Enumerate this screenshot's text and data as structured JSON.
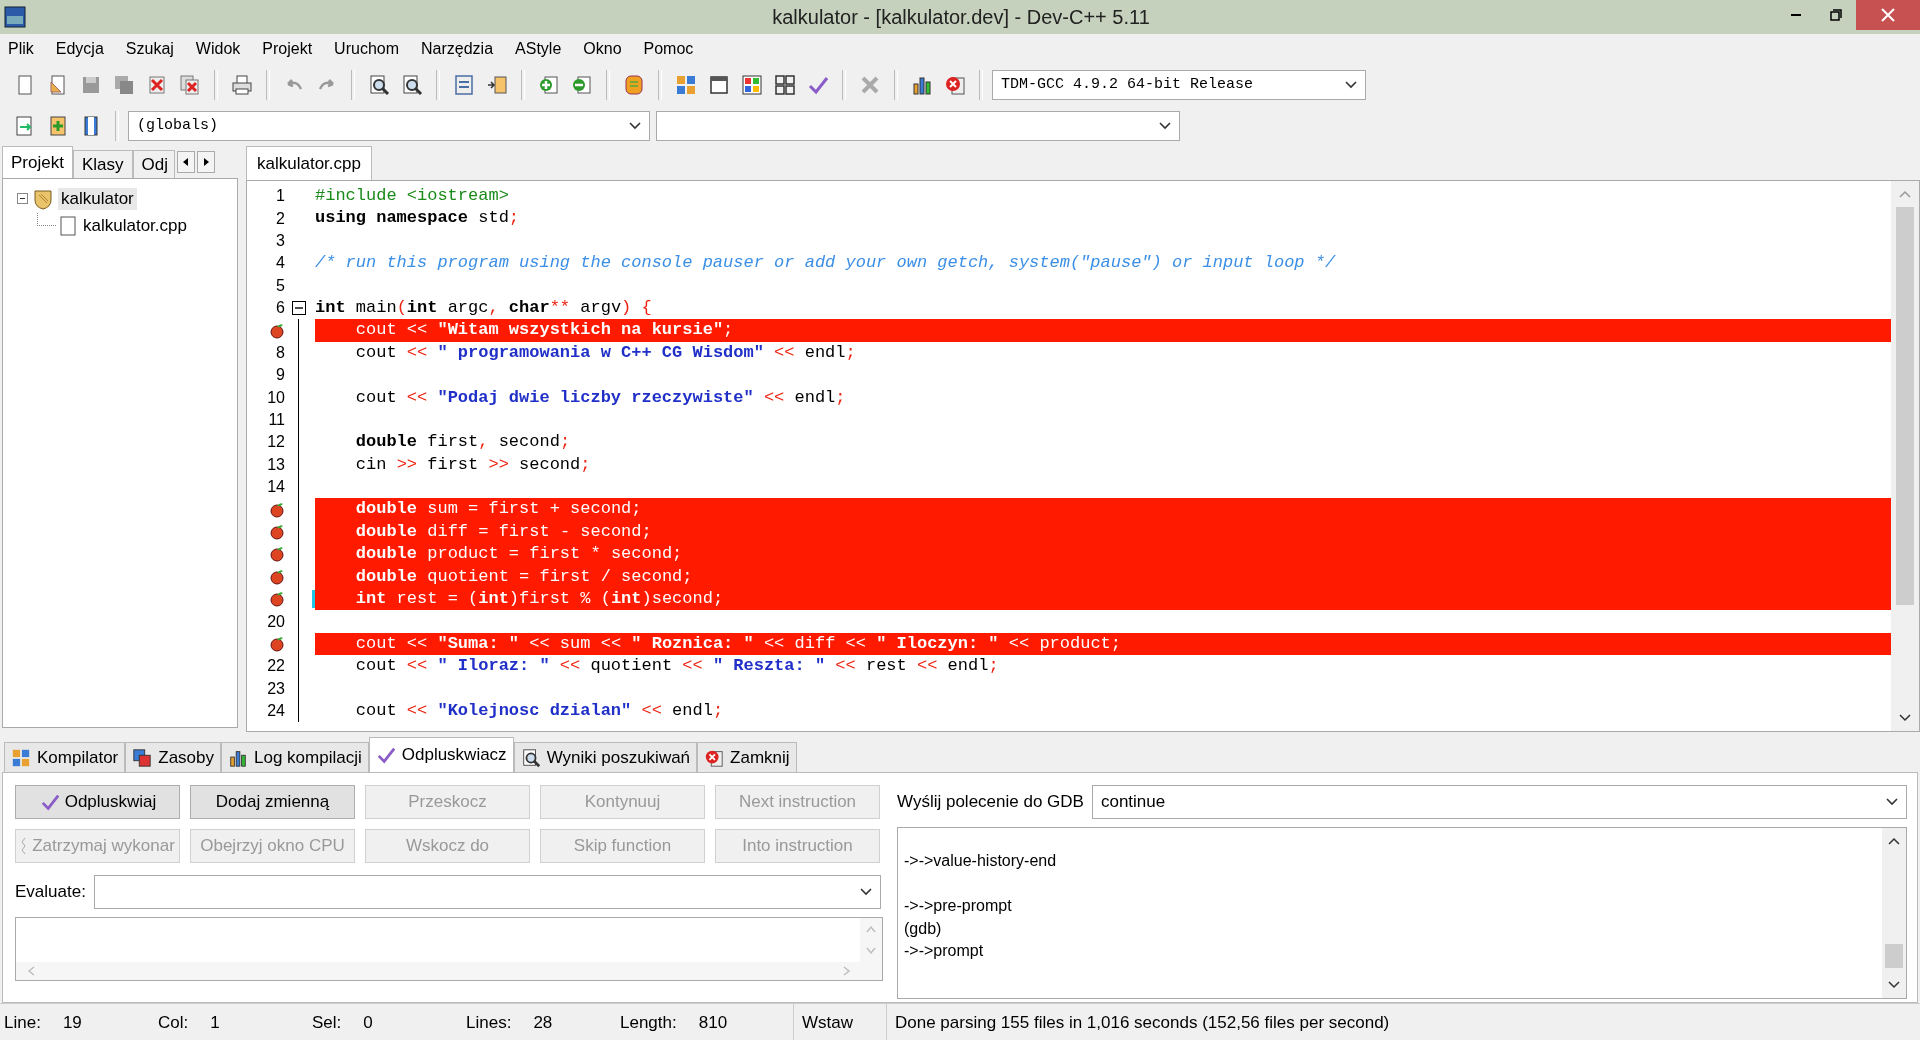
{
  "window": {
    "title": "kalkulator - [kalkulator.dev] - Dev-C++ 5.11"
  },
  "menu": [
    "Plik",
    "Edycja",
    "Szukaj",
    "Widok",
    "Projekt",
    "Uruchom",
    "Narzędzia",
    "AStyle",
    "Okno",
    "Pomoc"
  ],
  "toolbar": {
    "compiler": "TDM-GCC 4.9.2 64-bit Release",
    "scope": "(globals)"
  },
  "left_panel": {
    "tabs": [
      {
        "label": "Projekt",
        "selected": true
      },
      {
        "label": "Klasy",
        "selected": false
      },
      {
        "label": "Odj",
        "selected": false
      }
    ],
    "tree": [
      {
        "label": "kalkulator",
        "expanded": true,
        "children": [
          {
            "label": "kalkulator.cpp"
          }
        ]
      }
    ]
  },
  "editor": {
    "tabs": [
      {
        "label": "kalkulator.cpp",
        "selected": true
      }
    ],
    "lines": [
      {
        "number": "1",
        "tokens": [
          {
            "kind": "pp",
            "text": "#include <iostream>"
          }
        ]
      },
      {
        "number": "2",
        "tokens": [
          {
            "kind": "kw",
            "text": "using namespace"
          },
          {
            "kind": "id",
            "text": " std"
          },
          {
            "kind": "sym",
            "text": ";"
          }
        ]
      },
      {
        "number": "3"
      },
      {
        "number": "4",
        "tokens": [
          {
            "kind": "cm",
            "text": "/* run this program using the console pauser or add your own getch, system(\"pause\") or input loop */"
          }
        ]
      },
      {
        "number": "5"
      },
      {
        "number": "6",
        "fold_start": true,
        "tokens": [
          {
            "kind": "kw",
            "text": "int"
          },
          {
            "kind": "id",
            "text": " main"
          },
          {
            "kind": "sym",
            "text": "("
          },
          {
            "kind": "kw",
            "text": "int"
          },
          {
            "kind": "id",
            "text": " argc"
          },
          {
            "kind": "sym",
            "text": ","
          },
          {
            "kind": "kw",
            "text": " char"
          },
          {
            "kind": "sym",
            "text": "**"
          },
          {
            "kind": "id",
            "text": " argv"
          },
          {
            "kind": "sym",
            "text": ") {"
          }
        ]
      },
      {
        "breakpoint": true,
        "tokens": [
          {
            "kind": "id",
            "text": "    cout "
          },
          {
            "kind": "sym",
            "text": "<<"
          },
          {
            "kind": "str",
            "text": " \"Witam wszystkich na kursie\""
          },
          {
            "kind": "sym",
            "text": ";"
          }
        ]
      },
      {
        "number": "8",
        "tokens": [
          {
            "kind": "id",
            "text": "    cout "
          },
          {
            "kind": "sym",
            "text": "<<"
          },
          {
            "kind": "str",
            "text": " \" programowania w C++ CG Wisdom\""
          },
          {
            "kind": "sym",
            "text": " <<"
          },
          {
            "kind": "id",
            "text": " endl"
          },
          {
            "kind": "sym",
            "text": ";"
          }
        ]
      },
      {
        "number": "9"
      },
      {
        "number": "10",
        "tokens": [
          {
            "kind": "id",
            "text": "    cout "
          },
          {
            "kind": "sym",
            "text": "<<"
          },
          {
            "kind": "str",
            "text": " \"Podaj dwie liczby rzeczywiste\""
          },
          {
            "kind": "sym",
            "text": " <<"
          },
          {
            "kind": "id",
            "text": " endl"
          },
          {
            "kind": "sym",
            "text": ";"
          }
        ]
      },
      {
        "number": "11"
      },
      {
        "number": "12",
        "tokens": [
          {
            "kind": "kw",
            "text": "    double"
          },
          {
            "kind": "id",
            "text": " first"
          },
          {
            "kind": "sym",
            "text": ","
          },
          {
            "kind": "id",
            "text": " second"
          },
          {
            "kind": "sym",
            "text": ";"
          }
        ]
      },
      {
        "number": "13",
        "tokens": [
          {
            "kind": "id",
            "text": "    cin "
          },
          {
            "kind": "sym",
            "text": ">>"
          },
          {
            "kind": "id",
            "text": " first "
          },
          {
            "kind": "sym",
            "text": ">>"
          },
          {
            "kind": "id",
            "text": " second"
          },
          {
            "kind": "sym",
            "text": ";"
          }
        ]
      },
      {
        "number": "14"
      },
      {
        "breakpoint": true,
        "tokens": [
          {
            "kind": "kw",
            "text": "    double"
          },
          {
            "kind": "id",
            "text": " sum "
          },
          {
            "kind": "sym",
            "text": "="
          },
          {
            "kind": "id",
            "text": " first "
          },
          {
            "kind": "sym",
            "text": "+"
          },
          {
            "kind": "id",
            "text": " second"
          },
          {
            "kind": "sym",
            "text": ";"
          }
        ]
      },
      {
        "breakpoint": true,
        "tokens": [
          {
            "kind": "kw",
            "text": "    double"
          },
          {
            "kind": "id",
            "text": " diff "
          },
          {
            "kind": "sym",
            "text": "="
          },
          {
            "kind": "id",
            "text": " first "
          },
          {
            "kind": "sym",
            "text": "-"
          },
          {
            "kind": "id",
            "text": " second"
          },
          {
            "kind": "sym",
            "text": ";"
          }
        ]
      },
      {
        "breakpoint": true,
        "tokens": [
          {
            "kind": "kw",
            "text": "    double"
          },
          {
            "kind": "id",
            "text": " product "
          },
          {
            "kind": "sym",
            "text": "="
          },
          {
            "kind": "id",
            "text": " first "
          },
          {
            "kind": "sym",
            "text": "*"
          },
          {
            "kind": "id",
            "text": " second"
          },
          {
            "kind": "sym",
            "text": ";"
          }
        ]
      },
      {
        "breakpoint": true,
        "tokens": [
          {
            "kind": "kw",
            "text": "    double"
          },
          {
            "kind": "id",
            "text": " quotient "
          },
          {
            "kind": "sym",
            "text": "="
          },
          {
            "kind": "id",
            "text": " first "
          },
          {
            "kind": "sym",
            "text": "/"
          },
          {
            "kind": "id",
            "text": " second"
          },
          {
            "kind": "sym",
            "text": ";"
          }
        ]
      },
      {
        "breakpoint": true,
        "current": true,
        "tokens": [
          {
            "kind": "kw",
            "text": "    int"
          },
          {
            "kind": "id",
            "text": " rest "
          },
          {
            "kind": "sym",
            "text": "= ("
          },
          {
            "kind": "kw",
            "text": "int"
          },
          {
            "kind": "sym",
            "text": ")"
          },
          {
            "kind": "id",
            "text": "first "
          },
          {
            "kind": "sym",
            "text": "% ("
          },
          {
            "kind": "kw",
            "text": "int"
          },
          {
            "kind": "sym",
            "text": ")"
          },
          {
            "kind": "id",
            "text": "second"
          },
          {
            "kind": "sym",
            "text": ";"
          }
        ]
      },
      {
        "number": "20"
      },
      {
        "breakpoint": true,
        "tokens": [
          {
            "kind": "id",
            "text": "    cout "
          },
          {
            "kind": "sym",
            "text": "<<"
          },
          {
            "kind": "str",
            "text": " \"Suma: \""
          },
          {
            "kind": "sym",
            "text": " <<"
          },
          {
            "kind": "id",
            "text": " sum "
          },
          {
            "kind": "sym",
            "text": "<<"
          },
          {
            "kind": "str",
            "text": " \" Roznica: \""
          },
          {
            "kind": "sym",
            "text": " <<"
          },
          {
            "kind": "id",
            "text": " diff "
          },
          {
            "kind": "sym",
            "text": "<<"
          },
          {
            "kind": "str",
            "text": " \" Iloczyn: \""
          },
          {
            "kind": "sym",
            "text": " <<"
          },
          {
            "kind": "id",
            "text": " product"
          },
          {
            "kind": "sym",
            "text": ";"
          }
        ]
      },
      {
        "number": "22",
        "tokens": [
          {
            "kind": "id",
            "text": "    cout "
          },
          {
            "kind": "sym",
            "text": "<<"
          },
          {
            "kind": "str",
            "text": " \" Iloraz: \""
          },
          {
            "kind": "sym",
            "text": " <<"
          },
          {
            "kind": "id",
            "text": " quotient "
          },
          {
            "kind": "sym",
            "text": "<<"
          },
          {
            "kind": "str",
            "text": " \" Reszta: \""
          },
          {
            "kind": "sym",
            "text": " <<"
          },
          {
            "kind": "id",
            "text": " rest "
          },
          {
            "kind": "sym",
            "text": "<<"
          },
          {
            "kind": "id",
            "text": " endl"
          },
          {
            "kind": "sym",
            "text": ";"
          }
        ]
      },
      {
        "number": "23"
      },
      {
        "number": "24",
        "tokens": [
          {
            "kind": "id",
            "text": "    cout "
          },
          {
            "kind": "sym",
            "text": "<<"
          },
          {
            "kind": "str",
            "text": " \"Kolejnosc dzialan\""
          },
          {
            "kind": "sym",
            "text": " <<"
          },
          {
            "kind": "id",
            "text": " endl"
          },
          {
            "kind": "sym",
            "text": ";"
          }
        ]
      }
    ]
  },
  "bottom_tabs": [
    {
      "label": "Kompilator",
      "selected": false
    },
    {
      "label": "Zasoby",
      "selected": false
    },
    {
      "label": "Log kompilacji",
      "selected": false
    },
    {
      "label": "Odpluskwiacz",
      "selected": true
    },
    {
      "label": "Wyniki poszukiwań",
      "selected": false
    },
    {
      "label": "Zamknij",
      "selected": false
    }
  ],
  "debugger": {
    "buttons": [
      {
        "label": "Odpluskwiaj",
        "disabled": false
      },
      {
        "label": "Dodaj zmienną",
        "disabled": false
      },
      {
        "label": "Przeskocz",
        "disabled": true
      },
      {
        "label": "Kontynuuj",
        "disabled": true
      },
      {
        "label": "Next instruction",
        "disabled": true
      },
      {
        "label": "Zatrzymaj wykonar",
        "disabled": true
      },
      {
        "label": "Obejrzyj okno CPU",
        "disabled": true
      },
      {
        "label": "Wskocz do",
        "disabled": true
      },
      {
        "label": "Skip function",
        "disabled": true
      },
      {
        "label": "Into instruction",
        "disabled": true
      }
    ],
    "evaluate_label": "Evaluate:",
    "gdb_label": "Wyślij polecenie do GDB",
    "gdb_command": "continue",
    "gdb_output": [
      [
        "->->value-history-end"
      ],
      [
        "->->pre-prompt",
        "(gdb)",
        "->->prompt"
      ]
    ]
  },
  "status_bar": {
    "fields": [
      {
        "label": "Line:",
        "value": "19"
      },
      {
        "label": "Col:",
        "value": "1"
      },
      {
        "label": "Sel:",
        "value": "0"
      },
      {
        "label": "Lines:",
        "value": "28"
      },
      {
        "label": "Length:",
        "value": "810"
      }
    ],
    "mode": "Wstaw",
    "message": "Done parsing 155 files in 1,016 seconds (152,56 files per second)"
  }
}
